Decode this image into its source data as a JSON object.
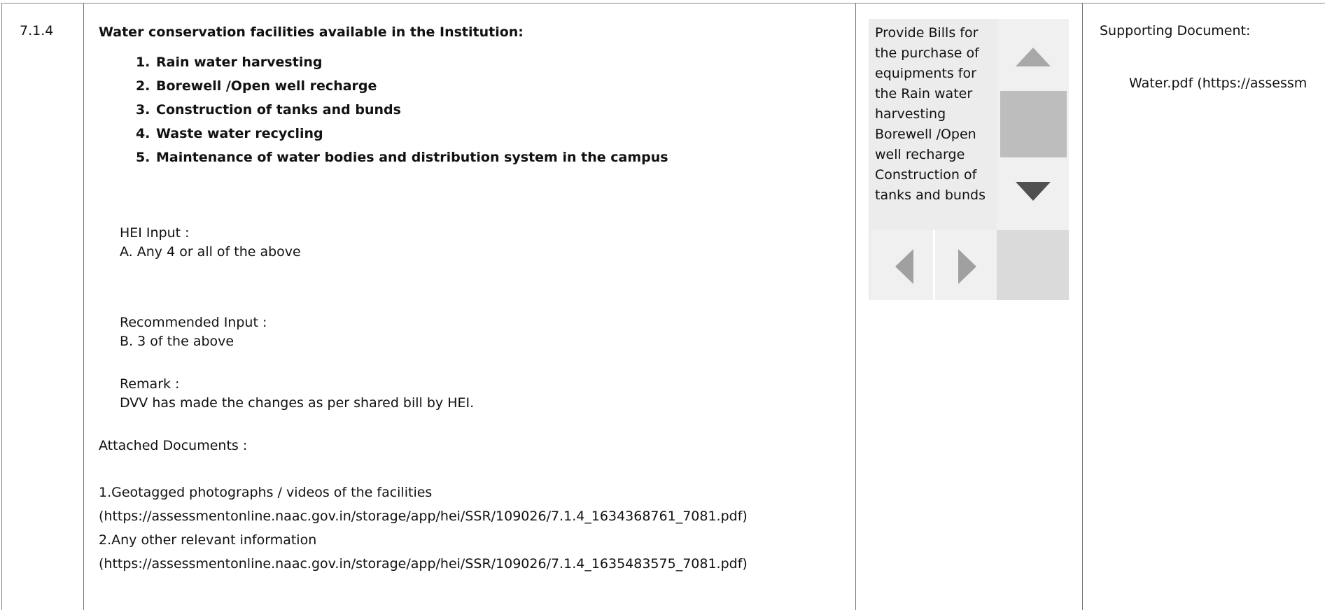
{
  "row": {
    "metric_no": "7.1.4",
    "heading": "Water conservation facilities available in the Institution:",
    "criteria": [
      "Rain water harvesting",
      "Borewell /Open well recharge",
      "Construction of tanks and bunds",
      "Waste water recycling",
      "Maintenance of water bodies and distribution system in the campus"
    ],
    "hei_input_label": "HEI Input :",
    "hei_input_value": "A. Any 4 or all of the above",
    "recommended_label": "Recommended Input :",
    "recommended_value": "B. 3 of the above",
    "remark_label": "Remark :",
    "remark_value": "DVV has made the changes as per shared bill by HEI.",
    "attached_label": "Attached Documents :",
    "attachments": [
      "1.Geotagged photographs / videos of the facilities",
      "(https://assessmentonline.naac.gov.in/storage/app/hei/SSR/109026/7.1.4_1634368761_7081.pdf)",
      "2.Any other relevant information",
      "(https://assessmentonline.naac.gov.in/storage/app/hei/SSR/109026/7.1.4_1635483575_7081.pdf)"
    ]
  },
  "dvv_note": {
    "text": "Provide Bills for the purchase of equipments for the Rain water harvesting Borewell /Open well recharge Construction of tanks and bunds"
  },
  "supporting": {
    "label": "Supporting Document:",
    "file": "Water.pdf (https://assessm"
  }
}
